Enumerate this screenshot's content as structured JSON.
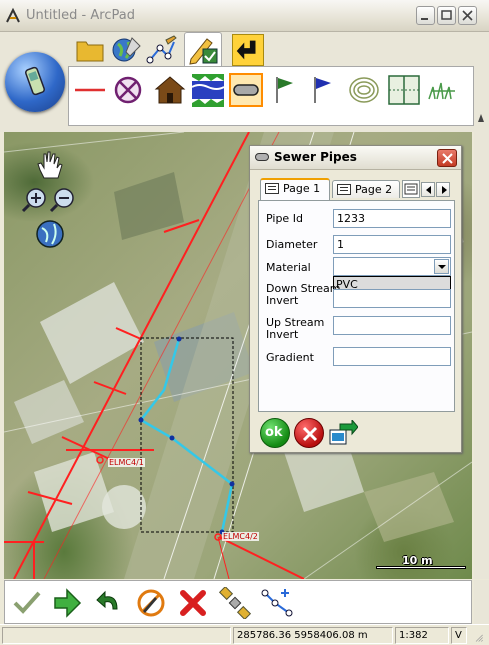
{
  "window": {
    "title": "Untitled - ArcPad"
  },
  "toolbar": {
    "tabs": [
      "folder",
      "map-layers",
      "editing-vertices",
      "editing",
      "back"
    ],
    "active_tab": "editing",
    "tools": [
      "line",
      "circle-target",
      "building",
      "river",
      "pipe",
      "flag-green",
      "flag-blue",
      "contours",
      "grid-panel",
      "grass"
    ],
    "active_tool": "pipe"
  },
  "map": {
    "labels": {
      "label1": "ELMC4/1",
      "label2": "ELMC4/2"
    },
    "scale_text": "10 m"
  },
  "dialog": {
    "title": "Sewer Pipes",
    "tabs": [
      {
        "label": "Page 1",
        "active": true
      },
      {
        "label": "Page 2",
        "active": false
      }
    ],
    "fields": {
      "pipe_id": {
        "label": "Pipe Id",
        "value": "1233"
      },
      "diameter": {
        "label": "Diameter",
        "value": "1"
      },
      "material": {
        "label": "Material",
        "value": "",
        "dropdown_option": "PVC"
      },
      "down_stream_invert": {
        "label_line1": "Down Stream",
        "label_line2": "Invert",
        "value": ""
      },
      "up_stream_invert": {
        "label_line1": "Up Stream",
        "label_line2": "Invert",
        "value": ""
      },
      "gradient": {
        "label": "Gradient",
        "value": ""
      }
    },
    "buttons": {
      "ok_label": "ok"
    }
  },
  "bottom_toolbar": {
    "tools": [
      "check",
      "forward",
      "undo",
      "cancel-circle",
      "delete",
      "satellite",
      "vertices"
    ]
  },
  "statusbar": {
    "message": "",
    "coordinates": "285786.36 5958406.08 m",
    "scale": "1:382",
    "flag": "V"
  },
  "colors": {
    "pipe_highlight": "#34c8e8",
    "road_line": "#ff2020",
    "active_tool_border": "#ff8c00"
  }
}
